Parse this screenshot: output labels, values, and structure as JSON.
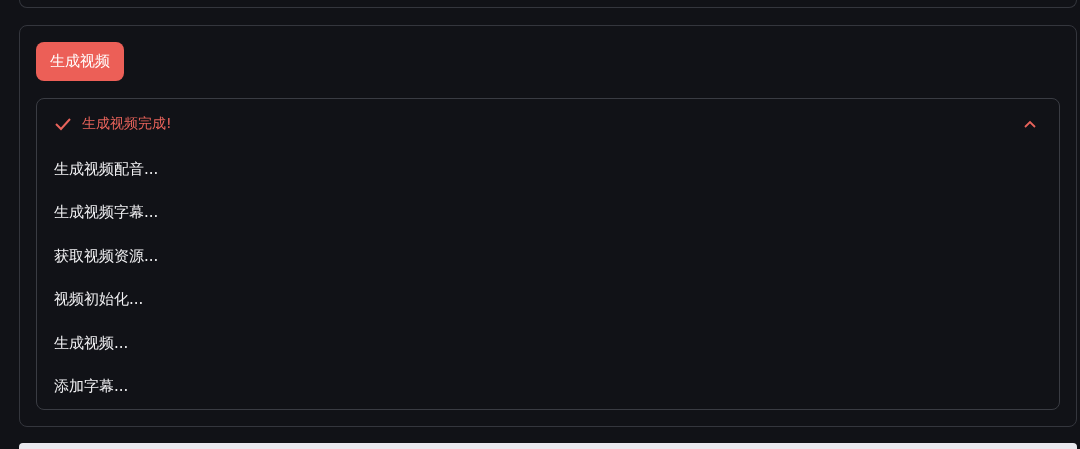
{
  "generate_button": {
    "label": "生成视频"
  },
  "progress": {
    "status": "生成视频完成!",
    "done": true,
    "expanded": true,
    "steps": [
      "生成视频配音...",
      "生成视频字幕...",
      "获取视频资源...",
      "视频初始化...",
      "生成视频...",
      "添加字幕..."
    ]
  }
}
